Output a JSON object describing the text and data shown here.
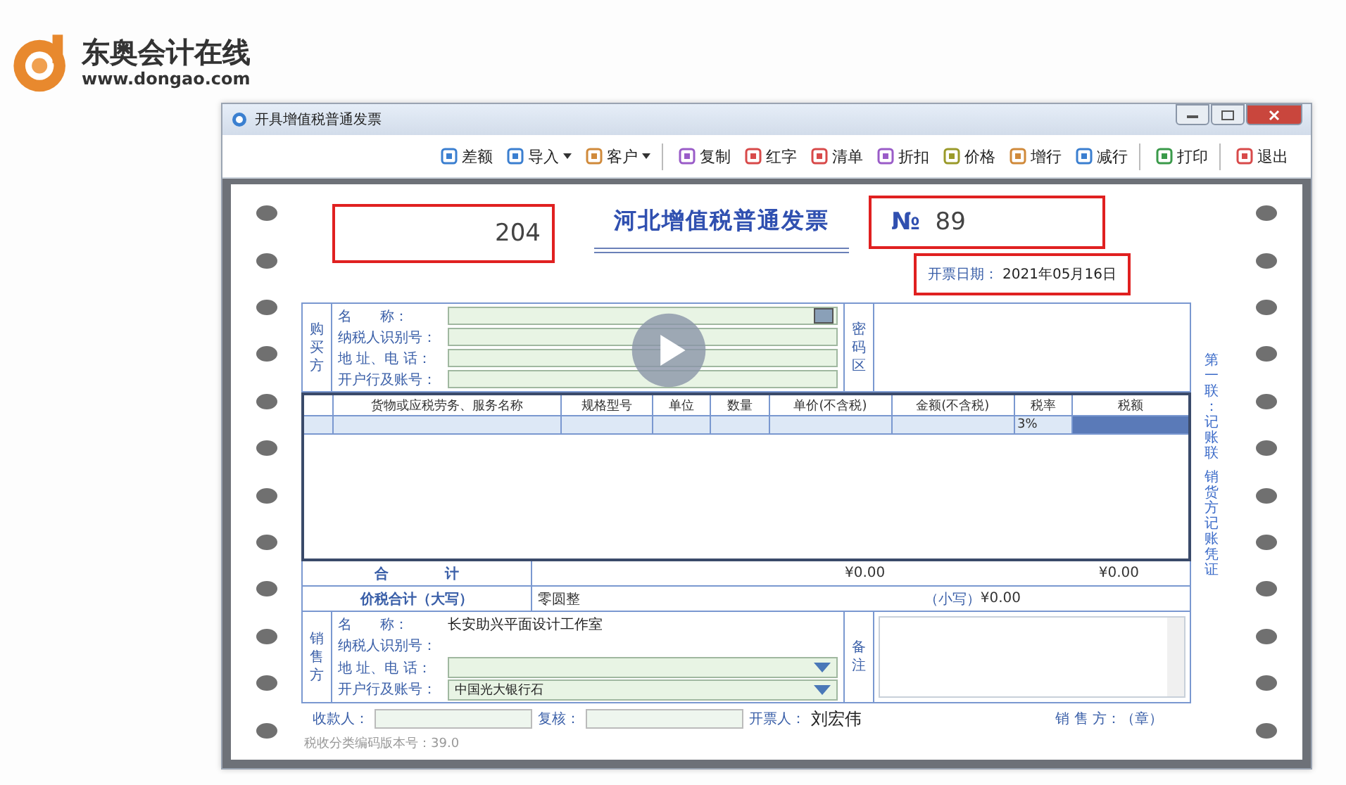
{
  "brand": {
    "name": "东奥会计在线",
    "url": "www.dongao.com"
  },
  "window": {
    "title": "开具增值税普通发票"
  },
  "toolbar": [
    {
      "label": "差额",
      "color": "#3b7fd0",
      "dropdown": false,
      "separator_after": false
    },
    {
      "label": "导入",
      "color": "#3b7fd0",
      "dropdown": true,
      "separator_after": false
    },
    {
      "label": "客户",
      "color": "#d08a3b",
      "dropdown": true,
      "separator_after": true
    },
    {
      "label": "复制",
      "color": "#9a5cc8",
      "dropdown": false,
      "separator_after": false
    },
    {
      "label": "红字",
      "color": "#d84a4a",
      "dropdown": false,
      "separator_after": false
    },
    {
      "label": "清单",
      "color": "#d84a4a",
      "dropdown": false,
      "separator_after": false
    },
    {
      "label": "折扣",
      "color": "#9a5cc8",
      "dropdown": false,
      "separator_after": false
    },
    {
      "label": "价格",
      "color": "#9a9a2a",
      "dropdown": false,
      "separator_after": false
    },
    {
      "label": "增行",
      "color": "#d08a3b",
      "dropdown": false,
      "separator_after": false
    },
    {
      "label": "减行",
      "color": "#3b7fd0",
      "dropdown": false,
      "separator_after": true
    },
    {
      "label": "打印",
      "color": "#3a9a4a",
      "dropdown": false,
      "separator_after": true
    },
    {
      "label": "退出",
      "color": "#d84a4a",
      "dropdown": false,
      "separator_after": false
    }
  ],
  "invoice": {
    "code": {
      "value": "204",
      "highlighted": true
    },
    "title": "河北增值税普通发票",
    "number": {
      "sign": "№",
      "value": "89",
      "highlighted": true
    },
    "date": {
      "label": "开票日期：",
      "value": "2021年05月16日",
      "highlighted": true
    },
    "buyer": {
      "side_label": "购买方",
      "fields": [
        {
          "label": "名　　称：",
          "kind": "lookup"
        },
        {
          "label": "纳税人识别号：",
          "kind": "text"
        },
        {
          "label": "地 址、电 话：",
          "kind": "text"
        },
        {
          "label": "开户行及账号：",
          "kind": "text"
        }
      ]
    },
    "password_label": "密码区",
    "items": {
      "columns": [
        "货物或应税劳务、服务名称",
        "规格型号",
        "单位",
        "数量",
        "单价(不含税)",
        "金额(不含税)",
        "税率",
        "税额"
      ],
      "row": {
        "tax_rate": "3%"
      }
    },
    "total": {
      "label": "合　　　　计",
      "amount": "¥0.00",
      "tax": "¥0.00"
    },
    "grand_total": {
      "label": "价税合计（大写）",
      "words": "零圆整",
      "small_label": "（小写）",
      "amount": "¥0.00"
    },
    "seller": {
      "side_label": "销售方",
      "fields": [
        {
          "label": "名　　称：",
          "kind": "plain",
          "value": "长安助兴平面设计工作室"
        },
        {
          "label": "纳税人识别号：",
          "kind": "plain"
        },
        {
          "label": "地 址、电 话：",
          "kind": "select"
        },
        {
          "label": "开户行及账号：",
          "kind": "select",
          "value": "中国光大银行石"
        }
      ]
    },
    "remarks_label": "备注",
    "side_note": [
      "第一联：记账联",
      "销货方记账凭证"
    ],
    "footer": {
      "payee_label": "收款人：",
      "reviewer_label": "复核：",
      "issuer_label": "开票人：",
      "issuer": "刘宏伟",
      "seller_label": "销 售 方：（章）"
    },
    "version": "税收分类编码版本号：39.0"
  }
}
